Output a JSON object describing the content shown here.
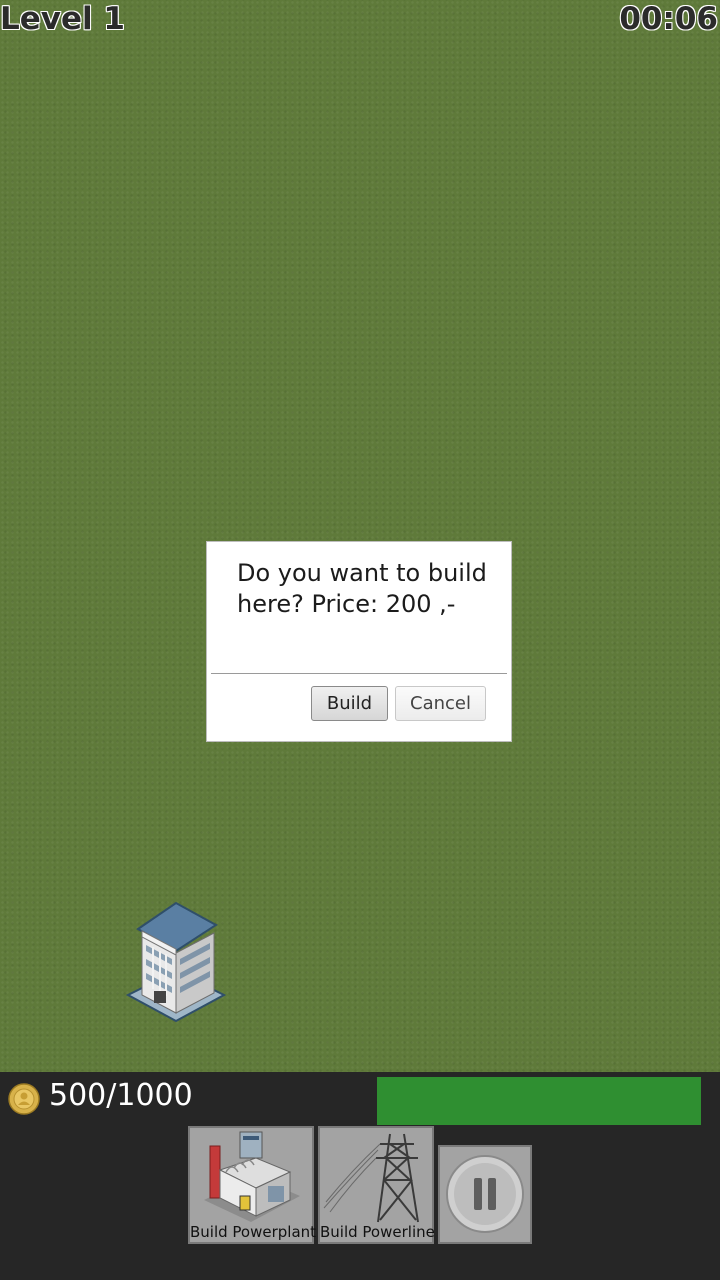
{
  "hud": {
    "level": "Level 1",
    "timer": "00:06"
  },
  "dialog": {
    "message": "Do you want to build here? Price: 200 ,-",
    "build_label": "Build",
    "cancel_label": "Cancel"
  },
  "status": {
    "money": "500/1000",
    "energy_fraction": 1.0
  },
  "toolbar": {
    "powerplant_label": "Build Powerplant",
    "powerline_label": "Build Powerline"
  },
  "colors": {
    "grass": "#5f7a3a",
    "energy_bar": "#2f8f31",
    "panel": "#262626"
  },
  "icons": [
    "coin-icon",
    "office-building",
    "powerplant-icon",
    "powerline-tower-icon",
    "pause-icon"
  ]
}
